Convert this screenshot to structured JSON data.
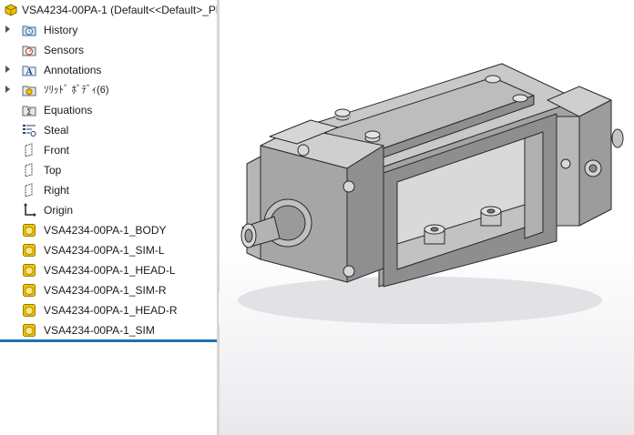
{
  "tree": {
    "root_label": "VSA4234-00PA-1  (Default<<Default>_Ph",
    "items": [
      {
        "label": "History",
        "icon": "history-icon"
      },
      {
        "label": "Sensors",
        "icon": "sensors-icon"
      },
      {
        "label": "Annotations",
        "icon": "annotations-icon"
      },
      {
        "label": "ｿﾘｯﾄﾞ ﾎﾞﾃﾞｨ(6)",
        "icon": "solid-bodies-icon"
      },
      {
        "label": "Equations",
        "icon": "equations-icon"
      },
      {
        "label": "Steal",
        "icon": "material-icon"
      },
      {
        "label": "Front",
        "icon": "plane-icon"
      },
      {
        "label": "Top",
        "icon": "plane-icon"
      },
      {
        "label": "Right",
        "icon": "plane-icon"
      },
      {
        "label": "Origin",
        "icon": "origin-icon"
      },
      {
        "label": "VSA4234-00PA-1_BODY",
        "icon": "part-icon"
      },
      {
        "label": "VSA4234-00PA-1_SIM-L",
        "icon": "part-icon"
      },
      {
        "label": "VSA4234-00PA-1_HEAD-L",
        "icon": "part-icon"
      },
      {
        "label": "VSA4234-00PA-1_SIM-R",
        "icon": "part-icon"
      },
      {
        "label": "VSA4234-00PA-1_HEAD-R",
        "icon": "part-icon"
      },
      {
        "label": "VSA4234-00PA-1_SIM",
        "icon": "part-icon"
      }
    ]
  },
  "colors": {
    "selection_line": "#1f6fb2",
    "part_icon": "#f2c300",
    "model_gray": "#b8b8b8"
  }
}
